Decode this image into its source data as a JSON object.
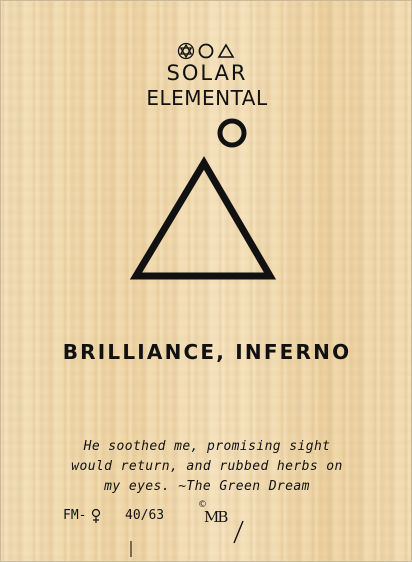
{
  "card": {
    "symbols": [
      "hexagram-in-circle-icon",
      "circle-icon",
      "triangle-icon"
    ],
    "title_line1": "SOLAR",
    "title_line2": "ELEMENTAL",
    "main_glyph": "sun-over-triangle-icon",
    "effect": "BRILLIANCE, INFERNO",
    "flavor_lines": [
      "He soothed me, promising sight",
      "would return, and rubbed herbs on",
      "my eyes. ~The Green Dream"
    ],
    "set_code": "FM-",
    "set_code_icon": "venus-icon",
    "number": "40/63",
    "copyright_symbol": "©",
    "artist": "MB",
    "ink_color": "#111111",
    "paper_color": "#f1dbb0"
  }
}
